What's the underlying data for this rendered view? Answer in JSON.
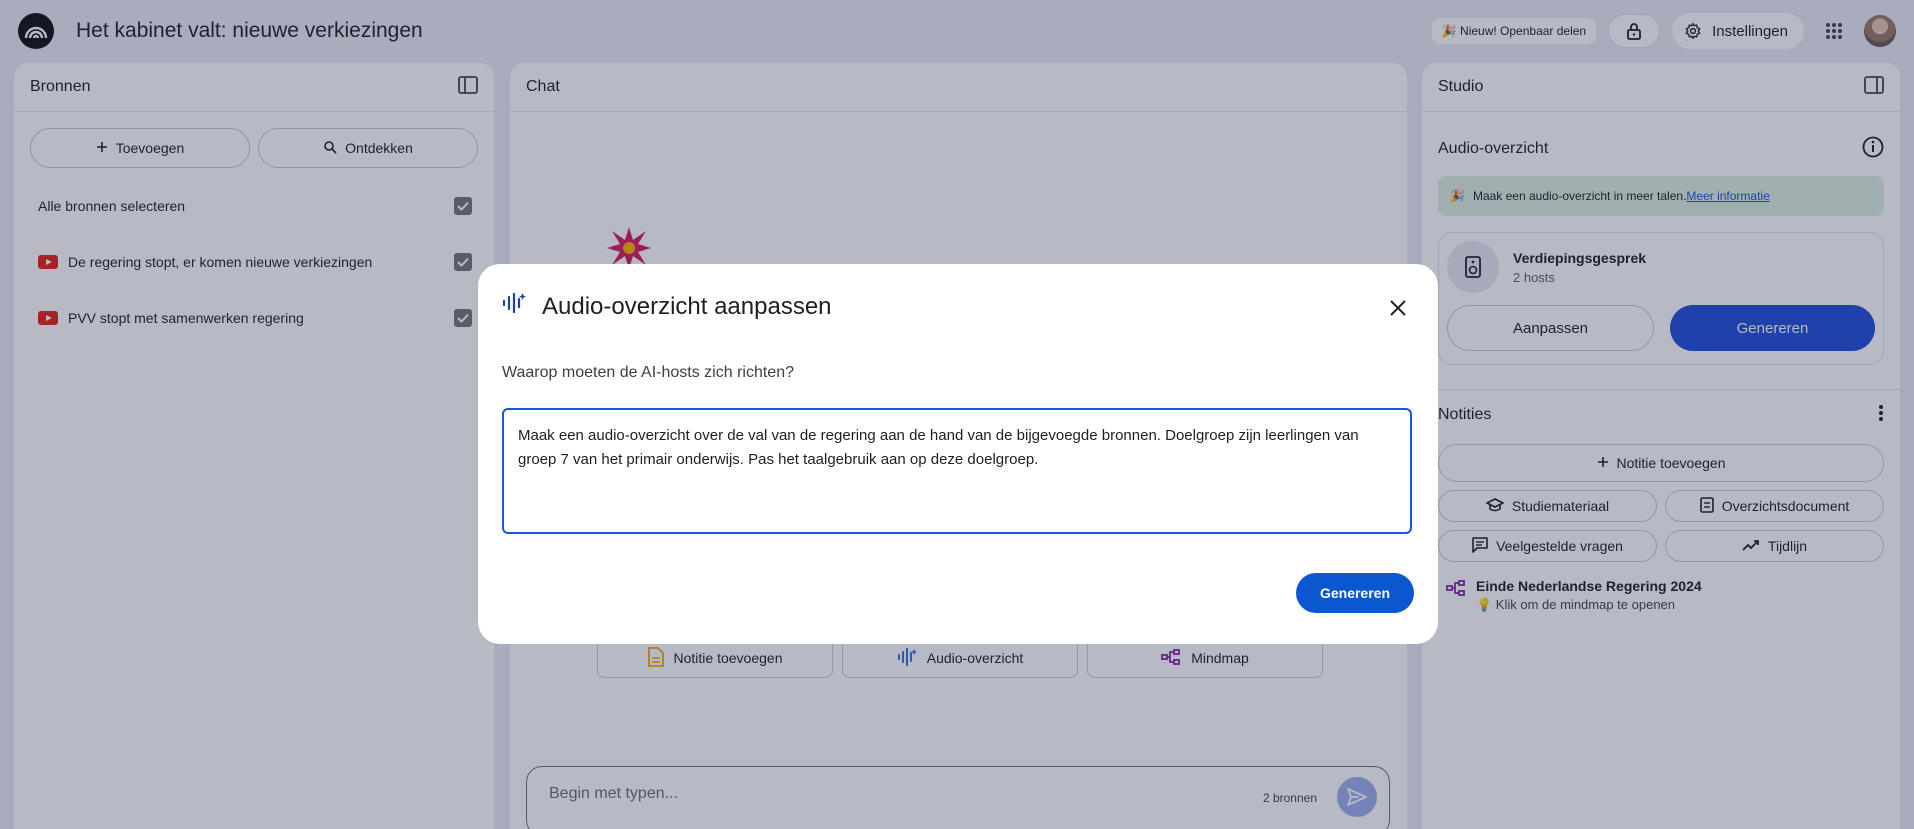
{
  "header": {
    "title": "Het kabinet valt: nieuwe verkiezingen",
    "share_badge": "🎉 Nieuw! Openbaar delen",
    "settings_label": "Instellingen"
  },
  "sources": {
    "title": "Bronnen",
    "add_label": "Toevoegen",
    "discover_label": "Ontdekken",
    "select_all_label": "Alle bronnen selecteren",
    "items": [
      {
        "label": "De regering stopt, er komen nieuwe verkiezingen"
      },
      {
        "label": "PVV stopt met samenwerken regering"
      }
    ]
  },
  "chat": {
    "title": "Chat",
    "suggestions": [
      {
        "label": "Notitie toevoegen"
      },
      {
        "label": "Audio-overzicht"
      },
      {
        "label": "Mindmap"
      }
    ],
    "input_placeholder": "Begin met typen...",
    "source_count": "2 bronnen"
  },
  "studio": {
    "title": "Studio",
    "audio_title": "Audio-overzicht",
    "banner_text": "Maak een audio-overzicht in meer talen.",
    "banner_link": "Meer informatie",
    "card_title": "Verdiepingsgesprek",
    "card_subtitle": "2 hosts",
    "customize_label": "Aanpassen",
    "generate_label": "Genereren",
    "notes_title": "Notities",
    "add_note_label": "Notitie toevoegen",
    "buttons": [
      {
        "label": "Studiemateriaal"
      },
      {
        "label": "Overzichtsdocument"
      },
      {
        "label": "Veelgestelde vragen"
      },
      {
        "label": "Tijdlijn"
      }
    ],
    "mindmap_title": "Einde Nederlandse Regering 2024",
    "mindmap_hint": "💡 Klik om de mindmap te openen"
  },
  "modal": {
    "title": "Audio-overzicht aanpassen",
    "question": "Waarop moeten de AI-hosts zich richten?",
    "prompt_value": "Maak een audio-overzicht over de val van de regering aan de hand van de bijgevoegde bronnen. Doelgroep zijn leerlingen van groep 7 van het primair onderwijs. Pas het taalgebruik aan op deze doelgroep.",
    "generate_label": "Genereren"
  },
  "colors": {
    "accent": "#0b57d0",
    "studio_generate": "#1f4fd8",
    "banner_bg": "#dff1e4",
    "mindmap_icon": "#8e24aa"
  }
}
